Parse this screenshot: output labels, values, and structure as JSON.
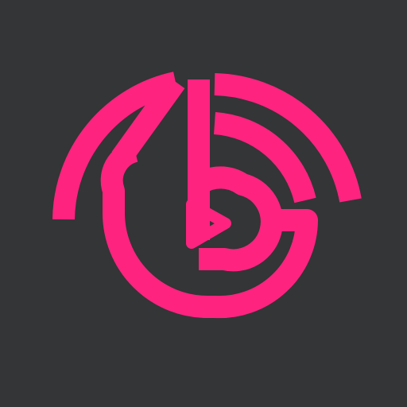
{
  "icon": {
    "name": "b-play-logo-icon",
    "colors": {
      "background": "#333536",
      "brand": "#FF2380"
    }
  }
}
